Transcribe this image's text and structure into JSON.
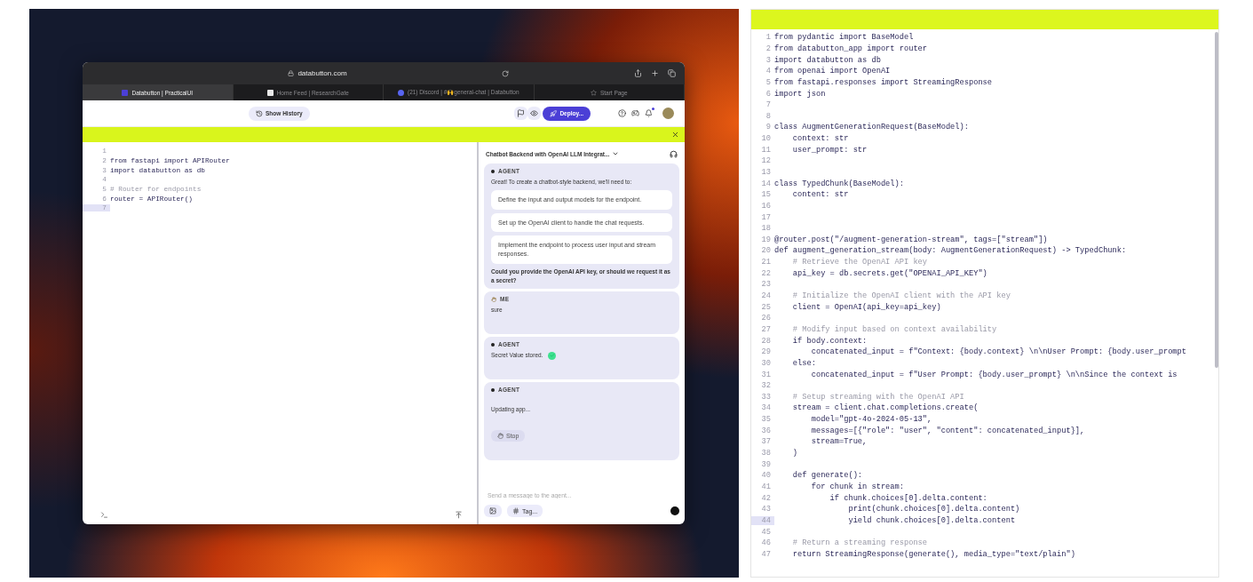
{
  "browser": {
    "url": "databutton.com",
    "tabs": [
      {
        "label": "Databutton | PracticalUI",
        "selected": true
      },
      {
        "label": "Home Feed | ResearchGate",
        "selected": false
      },
      {
        "label": "(21) Discord | #🙌general-chat | Databutton",
        "selected": false
      },
      {
        "label": "Start Page",
        "selected": false
      }
    ]
  },
  "toolbar": {
    "history_button": "Show History",
    "deploy_button": "Deploy...",
    "notification": true
  },
  "editor": {
    "lines": [
      {
        "n": "1",
        "kind": "blank",
        "selected": false
      },
      {
        "n": "2",
        "kind": "code",
        "text": "from fastapi import APIRouter",
        "selected": false
      },
      {
        "n": "3",
        "kind": "code",
        "text": "import databutton as db",
        "selected": false
      },
      {
        "n": "4",
        "kind": "blank",
        "selected": false
      },
      {
        "n": "5",
        "kind": "comment",
        "text": "# Router for endpoints",
        "selected": false
      },
      {
        "n": "6",
        "kind": "code",
        "text": "router = APIRouter()",
        "selected": false
      },
      {
        "n": "7",
        "kind": "blank",
        "selected": true
      }
    ]
  },
  "chat": {
    "title": "Chatbot Backend with OpenAI LLM Integrat...",
    "messages": [
      {
        "role": "AGENT",
        "kind": "steps",
        "intro": "Great! To create a chatbot-style backend, we'll need to:",
        "steps": [
          "Define the input and output models for the endpoint.",
          "Set up the OpenAI client to handle the chat requests.",
          "Implement the endpoint to process user input and stream responses."
        ],
        "question": "Could you provide the OpenAI API key, or should we request it as a secret?"
      },
      {
        "role": "ME",
        "kind": "text",
        "text": "sure"
      },
      {
        "role": "AGENT",
        "kind": "status",
        "text": "Secret Value stored."
      },
      {
        "role": "AGENT",
        "kind": "progress",
        "text": "Updating app...",
        "action": "Stop"
      }
    ],
    "input": {
      "placeholder": "Send a message to the agent..."
    },
    "tag_button": "Tag..."
  },
  "code_panel": {
    "lines": [
      {
        "n": "1",
        "kind": "code",
        "text": "from pydantic import BaseModel",
        "selected": false
      },
      {
        "n": "2",
        "kind": "code",
        "text": "from databutton_app import router",
        "selected": false
      },
      {
        "n": "3",
        "kind": "code",
        "text": "import databutton as db",
        "selected": false
      },
      {
        "n": "4",
        "kind": "code",
        "text": "from openai import OpenAI",
        "selected": false
      },
      {
        "n": "5",
        "kind": "code",
        "text": "from fastapi.responses import StreamingResponse",
        "selected": false
      },
      {
        "n": "6",
        "kind": "code",
        "text": "import json",
        "selected": false
      },
      {
        "n": "7",
        "kind": "blank",
        "selected": false
      },
      {
        "n": "8",
        "kind": "blank",
        "selected": false
      },
      {
        "n": "9",
        "kind": "code",
        "text": "class AugmentGenerationRequest(BaseModel):",
        "selected": false
      },
      {
        "n": "10",
        "kind": "code",
        "text": "    context: str",
        "selected": false
      },
      {
        "n": "11",
        "kind": "code",
        "text": "    user_prompt: str",
        "selected": false
      },
      {
        "n": "12",
        "kind": "blank",
        "selected": false
      },
      {
        "n": "13",
        "kind": "blank",
        "selected": false
      },
      {
        "n": "14",
        "kind": "code",
        "text": "class TypedChunk(BaseModel):",
        "selected": false
      },
      {
        "n": "15",
        "kind": "code",
        "text": "    content: str",
        "selected": false
      },
      {
        "n": "16",
        "kind": "blank",
        "selected": false
      },
      {
        "n": "17",
        "kind": "blank",
        "selected": false
      },
      {
        "n": "18",
        "kind": "blank",
        "selected": false
      },
      {
        "n": "19",
        "kind": "code",
        "text": "@router.post(\"/augment-generation-stream\", tags=[\"stream\"])",
        "selected": false
      },
      {
        "n": "20",
        "kind": "code",
        "text": "def augment_generation_stream(body: AugmentGenerationRequest) -> TypedChunk:",
        "selected": false
      },
      {
        "n": "21",
        "kind": "comment",
        "text": "    # Retrieve the OpenAI API key",
        "selected": false
      },
      {
        "n": "22",
        "kind": "code",
        "text": "    api_key = db.secrets.get(\"OPENAI_API_KEY\")",
        "selected": false
      },
      {
        "n": "23",
        "kind": "blank",
        "selected": false
      },
      {
        "n": "24",
        "kind": "comment",
        "text": "    # Initialize the OpenAI client with the API key",
        "selected": false
      },
      {
        "n": "25",
        "kind": "code",
        "text": "    client = OpenAI(api_key=api_key)",
        "selected": false
      },
      {
        "n": "26",
        "kind": "blank",
        "selected": false
      },
      {
        "n": "27",
        "kind": "comment",
        "text": "    # Modify input based on context availability",
        "selected": false
      },
      {
        "n": "28",
        "kind": "code",
        "text": "    if body.context:",
        "selected": false
      },
      {
        "n": "29",
        "kind": "code",
        "text": "        concatenated_input = f\"Context: {body.context} \\n\\nUser Prompt: {body.user_prompt",
        "selected": false
      },
      {
        "n": "30",
        "kind": "code",
        "text": "    else:",
        "selected": false
      },
      {
        "n": "31",
        "kind": "code",
        "text": "        concatenated_input = f\"User Prompt: {body.user_prompt} \\n\\nSince the context is",
        "selected": false
      },
      {
        "n": "32",
        "kind": "blank",
        "selected": false
      },
      {
        "n": "33",
        "kind": "comment",
        "text": "    # Setup streaming with the OpenAI API",
        "selected": false
      },
      {
        "n": "34",
        "kind": "code",
        "text": "    stream = client.chat.completions.create(",
        "selected": false
      },
      {
        "n": "35",
        "kind": "code",
        "text": "        model=\"gpt-4o-2024-05-13\",",
        "selected": false
      },
      {
        "n": "36",
        "kind": "code",
        "text": "        messages=[{\"role\": \"user\", \"content\": concatenated_input}],",
        "selected": false
      },
      {
        "n": "37",
        "kind": "code",
        "text": "        stream=True,",
        "selected": false
      },
      {
        "n": "38",
        "kind": "code",
        "text": "    )",
        "selected": false
      },
      {
        "n": "39",
        "kind": "blank",
        "selected": false
      },
      {
        "n": "40",
        "kind": "code",
        "text": "    def generate():",
        "selected": false
      },
      {
        "n": "41",
        "kind": "code",
        "text": "        for chunk in stream:",
        "selected": false
      },
      {
        "n": "42",
        "kind": "code",
        "text": "            if chunk.choices[0].delta.content:",
        "selected": false
      },
      {
        "n": "43",
        "kind": "code",
        "text": "                print(chunk.choices[0].delta.content)",
        "selected": false
      },
      {
        "n": "44",
        "kind": "code",
        "text": "                yield chunk.choices[0].delta.content",
        "selected": true
      },
      {
        "n": "45",
        "kind": "blank",
        "selected": false
      },
      {
        "n": "46",
        "kind": "comment",
        "text": "    # Return a streaming response",
        "selected": false
      },
      {
        "n": "47",
        "kind": "code",
        "text": "    return StreamingResponse(generate(), media_type=\"text/plain\")",
        "selected": false
      }
    ]
  }
}
